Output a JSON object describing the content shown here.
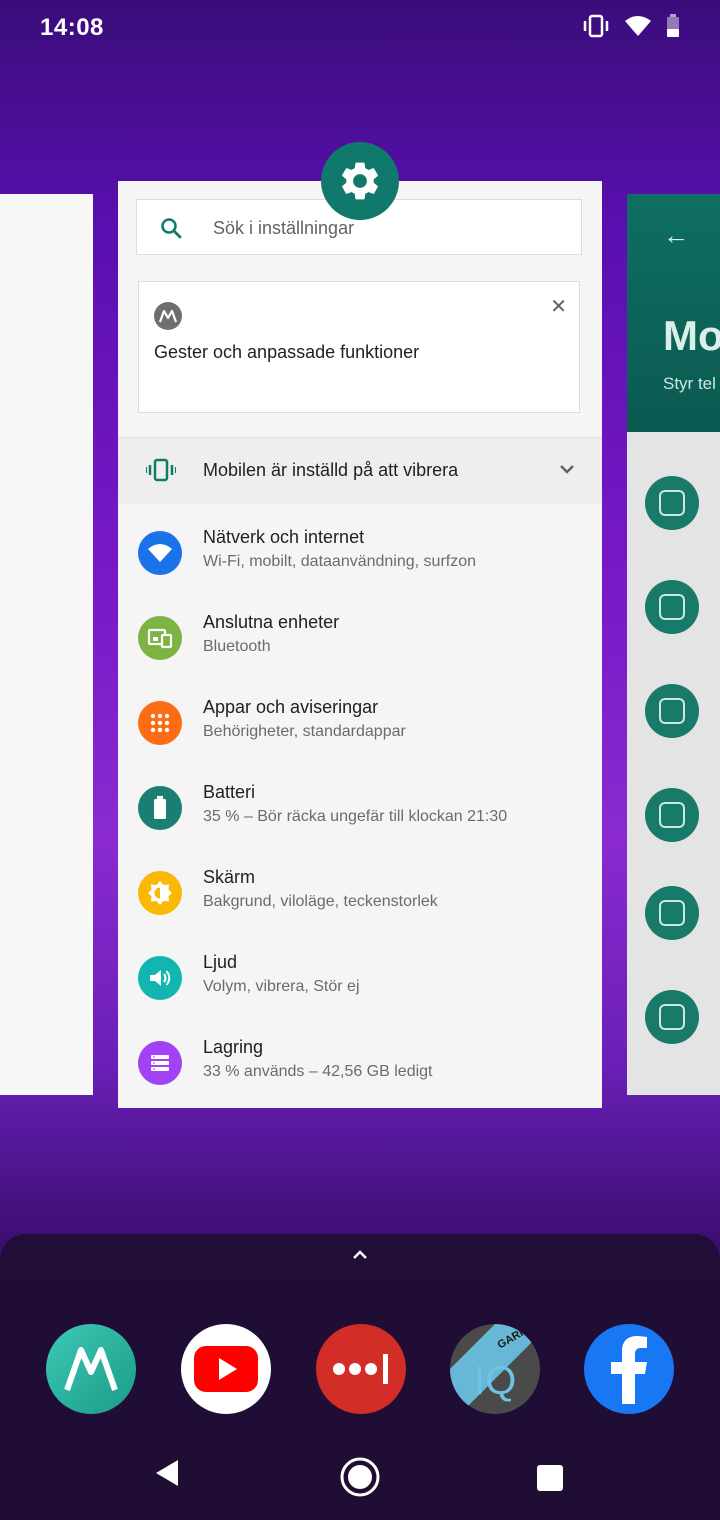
{
  "status_bar": {
    "time": "14:08",
    "icons": [
      "vibrate-icon",
      "wifi-icon",
      "battery-icon"
    ]
  },
  "right_card": {
    "title": "Mo",
    "subtitle": "Styr tel"
  },
  "main_card": {
    "app_icon": "settings-gear-icon",
    "search_placeholder": "Sök i inställningar",
    "suggestion": {
      "icon": "motorola-logo-icon",
      "title": "Gester och anpassade funktioner"
    },
    "vibrate_banner": "Mobilen är inställd på att vibrera",
    "items": [
      {
        "title": "Nätverk och internet",
        "subtitle": "Wi-Fi, mobilt, dataanvändning, surfzon",
        "color": "#1a73e8",
        "icon": "wifi-icon"
      },
      {
        "title": "Anslutna enheter",
        "subtitle": "Bluetooth",
        "color": "#7cb342",
        "icon": "devices-icon"
      },
      {
        "title": "Appar och aviseringar",
        "subtitle": "Behörigheter, standardappar",
        "color": "#fb6c14",
        "icon": "apps-icon"
      },
      {
        "title": "Batteri",
        "subtitle": "35 % – Bör räcka ungefär till klockan 21:30",
        "color": "#1a7f72",
        "icon": "battery-icon"
      },
      {
        "title": "Skärm",
        "subtitle": "Bakgrund, viloläge, teckenstorlek",
        "color": "#fbb805",
        "icon": "brightness-icon"
      },
      {
        "title": "Ljud",
        "subtitle": "Volym, vibrera, Stör ej",
        "color": "#12b5b0",
        "icon": "volume-icon"
      },
      {
        "title": "Lagring",
        "subtitle": "33 % används – 42,56 GB ledigt",
        "color": "#a142f4",
        "icon": "storage-icon"
      }
    ]
  },
  "dock": {
    "apps": [
      "moto-app-icon",
      "youtube-app-icon",
      "lastpass-app-icon",
      "garmin-connect-iq-app-icon",
      "facebook-app-icon"
    ],
    "garmin_label": "GARMIN",
    "garmin_iq": "IQ"
  },
  "nav": [
    "back-icon",
    "home-icon",
    "recents-icon"
  ]
}
